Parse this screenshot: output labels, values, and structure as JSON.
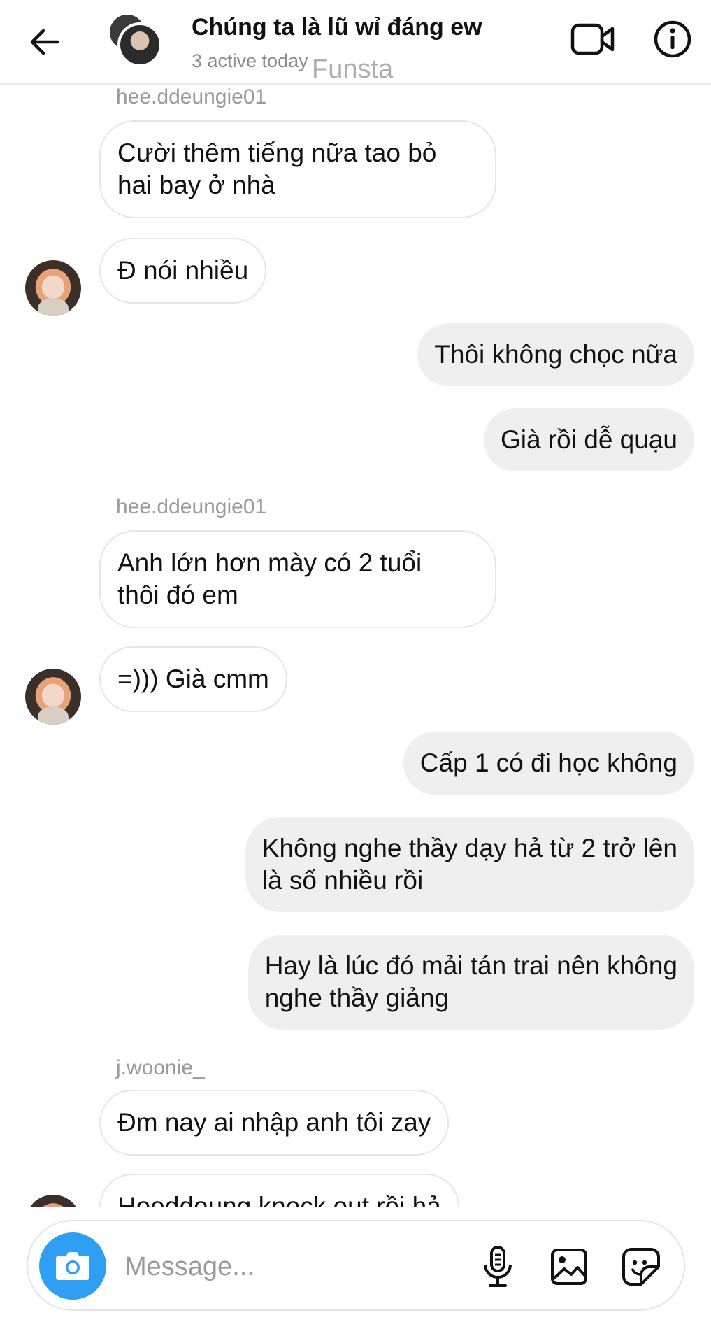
{
  "header": {
    "title": "Chúng ta là lũ wỉ đáng ew",
    "subtitle": "3 active today",
    "watermark": "Funsta",
    "icons": {
      "back": "arrow-left-icon",
      "video": "video-camera-icon",
      "info": "info-icon"
    }
  },
  "thread": {
    "senders": [
      "hee.ddeungie01",
      "hee.ddeungie01",
      "j.woonie_"
    ],
    "messages": [
      {
        "direction": "in",
        "lines": [
          "Cười thêm tiếng nữa tao bỏ",
          "hai bay ở nhà"
        ]
      },
      {
        "direction": "in",
        "lines": [
          "Đ nói nhiều"
        ]
      },
      {
        "direction": "out",
        "lines": [
          "Thôi không chọc nữa"
        ]
      },
      {
        "direction": "out",
        "lines": [
          "Già rồi dễ quạu"
        ]
      },
      {
        "direction": "in",
        "lines": [
          "Anh lớn hơn mày có 2 tuổi",
          "thôi đó em"
        ]
      },
      {
        "direction": "in",
        "lines": [
          "=))) Già cmm"
        ]
      },
      {
        "direction": "out",
        "lines": [
          "Cấp 1 có đi học không"
        ]
      },
      {
        "direction": "out",
        "lines": [
          "Không nghe thầy dạy hả từ 2 trở lên",
          "là số nhiều rồi"
        ]
      },
      {
        "direction": "out",
        "lines": [
          "Hay là lúc đó mải tán trai nên không",
          "nghe thầy giảng"
        ]
      },
      {
        "direction": "in",
        "lines": [
          "Đm nay ai nhập anh tôi zay"
        ]
      },
      {
        "direction": "in",
        "lines": [
          "Heeddeung knock out rồi hả"
        ]
      }
    ]
  },
  "composer": {
    "placeholder": "Message...",
    "icons": {
      "camera": "camera-icon",
      "mic": "microphone-icon",
      "gallery": "image-icon",
      "sticker": "sticker-icon"
    },
    "accent_color": "#2f9ff3"
  },
  "colors": {
    "outgoing_bubble": "#efefef",
    "incoming_border": "#e6e6e6",
    "meta_text": "#9a9a9a"
  }
}
